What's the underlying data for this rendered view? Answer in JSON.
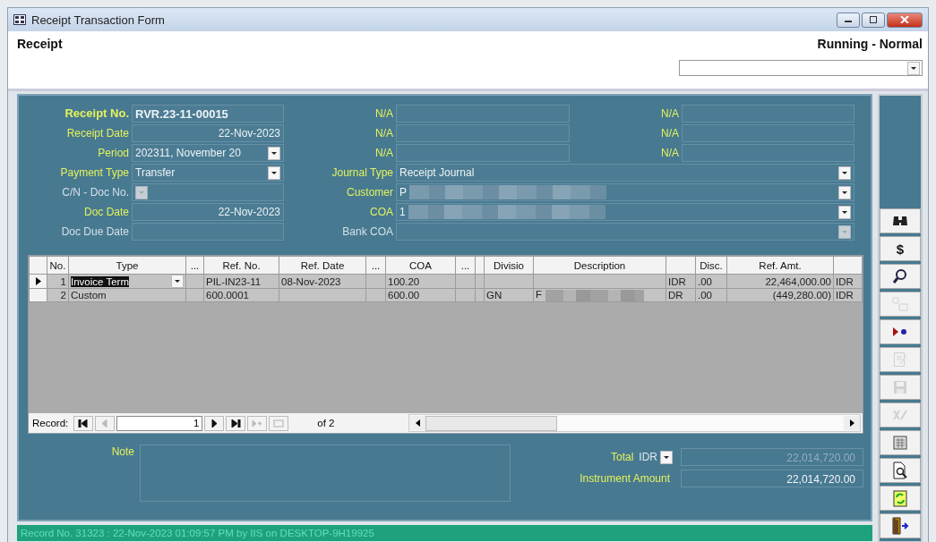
{
  "window": {
    "title": "Receipt Transaction Form"
  },
  "header": {
    "title": "Receipt",
    "mode": "Running - Normal"
  },
  "form": {
    "left": [
      {
        "label": "Receipt No.",
        "value": "RVR.23-11-00015",
        "kind": "text",
        "required": true
      },
      {
        "label": "Receipt Date",
        "value": "22-Nov-2023",
        "kind": "date",
        "required": true
      },
      {
        "label": "Period",
        "value": "202311, November 20",
        "kind": "combo",
        "required": true
      },
      {
        "label": "Payment Type",
        "value": "Transfer",
        "kind": "combo",
        "required": true
      },
      {
        "label": "C/N - Doc No.",
        "kind": "lookup",
        "required": false
      },
      {
        "label": "Doc Date",
        "value": "22-Nov-2023",
        "kind": "date",
        "required": true
      },
      {
        "label": "Doc Due Date",
        "kind": "date",
        "required": false
      }
    ],
    "middle": [
      {
        "label": "N/A"
      },
      {
        "label": "N/A"
      },
      {
        "label": "N/A"
      }
    ],
    "right": [
      {
        "label": "N/A"
      },
      {
        "label": "N/A"
      },
      {
        "label": "N/A"
      }
    ],
    "wide": [
      {
        "label": "Journal Type",
        "value": "Receipt Journal",
        "required": true,
        "redacted": false,
        "disabled": false
      },
      {
        "label": "Customer",
        "value": "P",
        "required": true,
        "redacted": true,
        "disabled": false
      },
      {
        "label": "COA",
        "value": "1",
        "required": true,
        "redacted": true,
        "disabled": false
      },
      {
        "label": "Bank COA",
        "required": false,
        "redacted": false,
        "disabled": true
      }
    ]
  },
  "table": {
    "columns": [
      {
        "label": "No."
      },
      {
        "label": "Type"
      },
      {
        "label": "..."
      },
      {
        "label": "Ref. No."
      },
      {
        "label": "Ref. Date"
      },
      {
        "label": "..."
      },
      {
        "label": "COA"
      },
      {
        "label": "..."
      },
      {},
      {
        "label": "Divisio"
      },
      {
        "label": "Description"
      },
      {},
      {
        "label": "Disc."
      },
      {
        "label": "Ref. Amt."
      },
      {}
    ],
    "rows": [
      {
        "selected": true,
        "redacted": false,
        "cells": [
          "1",
          "Invoice Term",
          null,
          "PIL-IN23-11",
          "08-Nov-2023",
          null,
          "100.20",
          null,
          null,
          null,
          null,
          "IDR",
          ".00",
          "22,464,000.00",
          "IDR"
        ]
      },
      {
        "selected": false,
        "redacted": true,
        "cells": [
          "2",
          "Custom",
          null,
          "600.0001",
          null,
          null,
          "600.00",
          null,
          null,
          "GN",
          "F",
          "DR",
          ".00",
          "(449,280.00)",
          "IDR"
        ]
      }
    ],
    "record_nav": {
      "label": "Record:",
      "current": "1",
      "of": "of 2",
      "buttons": [
        {
          "disabled": false
        },
        {
          "disabled": true
        },
        {
          "disabled": false
        },
        {
          "disabled": false
        },
        {
          "disabled": true
        },
        {
          "disabled": true
        }
      ]
    }
  },
  "note": {
    "label": "Note"
  },
  "total": {
    "label": "Total",
    "currency": "IDR",
    "value": "22,014,720.00",
    "disabled": true
  },
  "instrument_amount": {
    "label": "Instrument Amount",
    "value": "22,014,720.00"
  },
  "toolbar": [
    {
      "disabled": false
    },
    {
      "label": "$",
      "disabled": false
    },
    {
      "disabled": false
    },
    {
      "disabled": true
    },
    {
      "disabled": false
    },
    {
      "disabled": true
    },
    {
      "disabled": true
    },
    {
      "disabled": true
    },
    {
      "disabled": false
    },
    {
      "disabled": false
    },
    {
      "disabled": false
    },
    {
      "disabled": false
    }
  ],
  "status_bar": "Record No. 31323 : 22-Nov-2023 01:09:57 PM by IIS on DESKTOP-9H19925"
}
